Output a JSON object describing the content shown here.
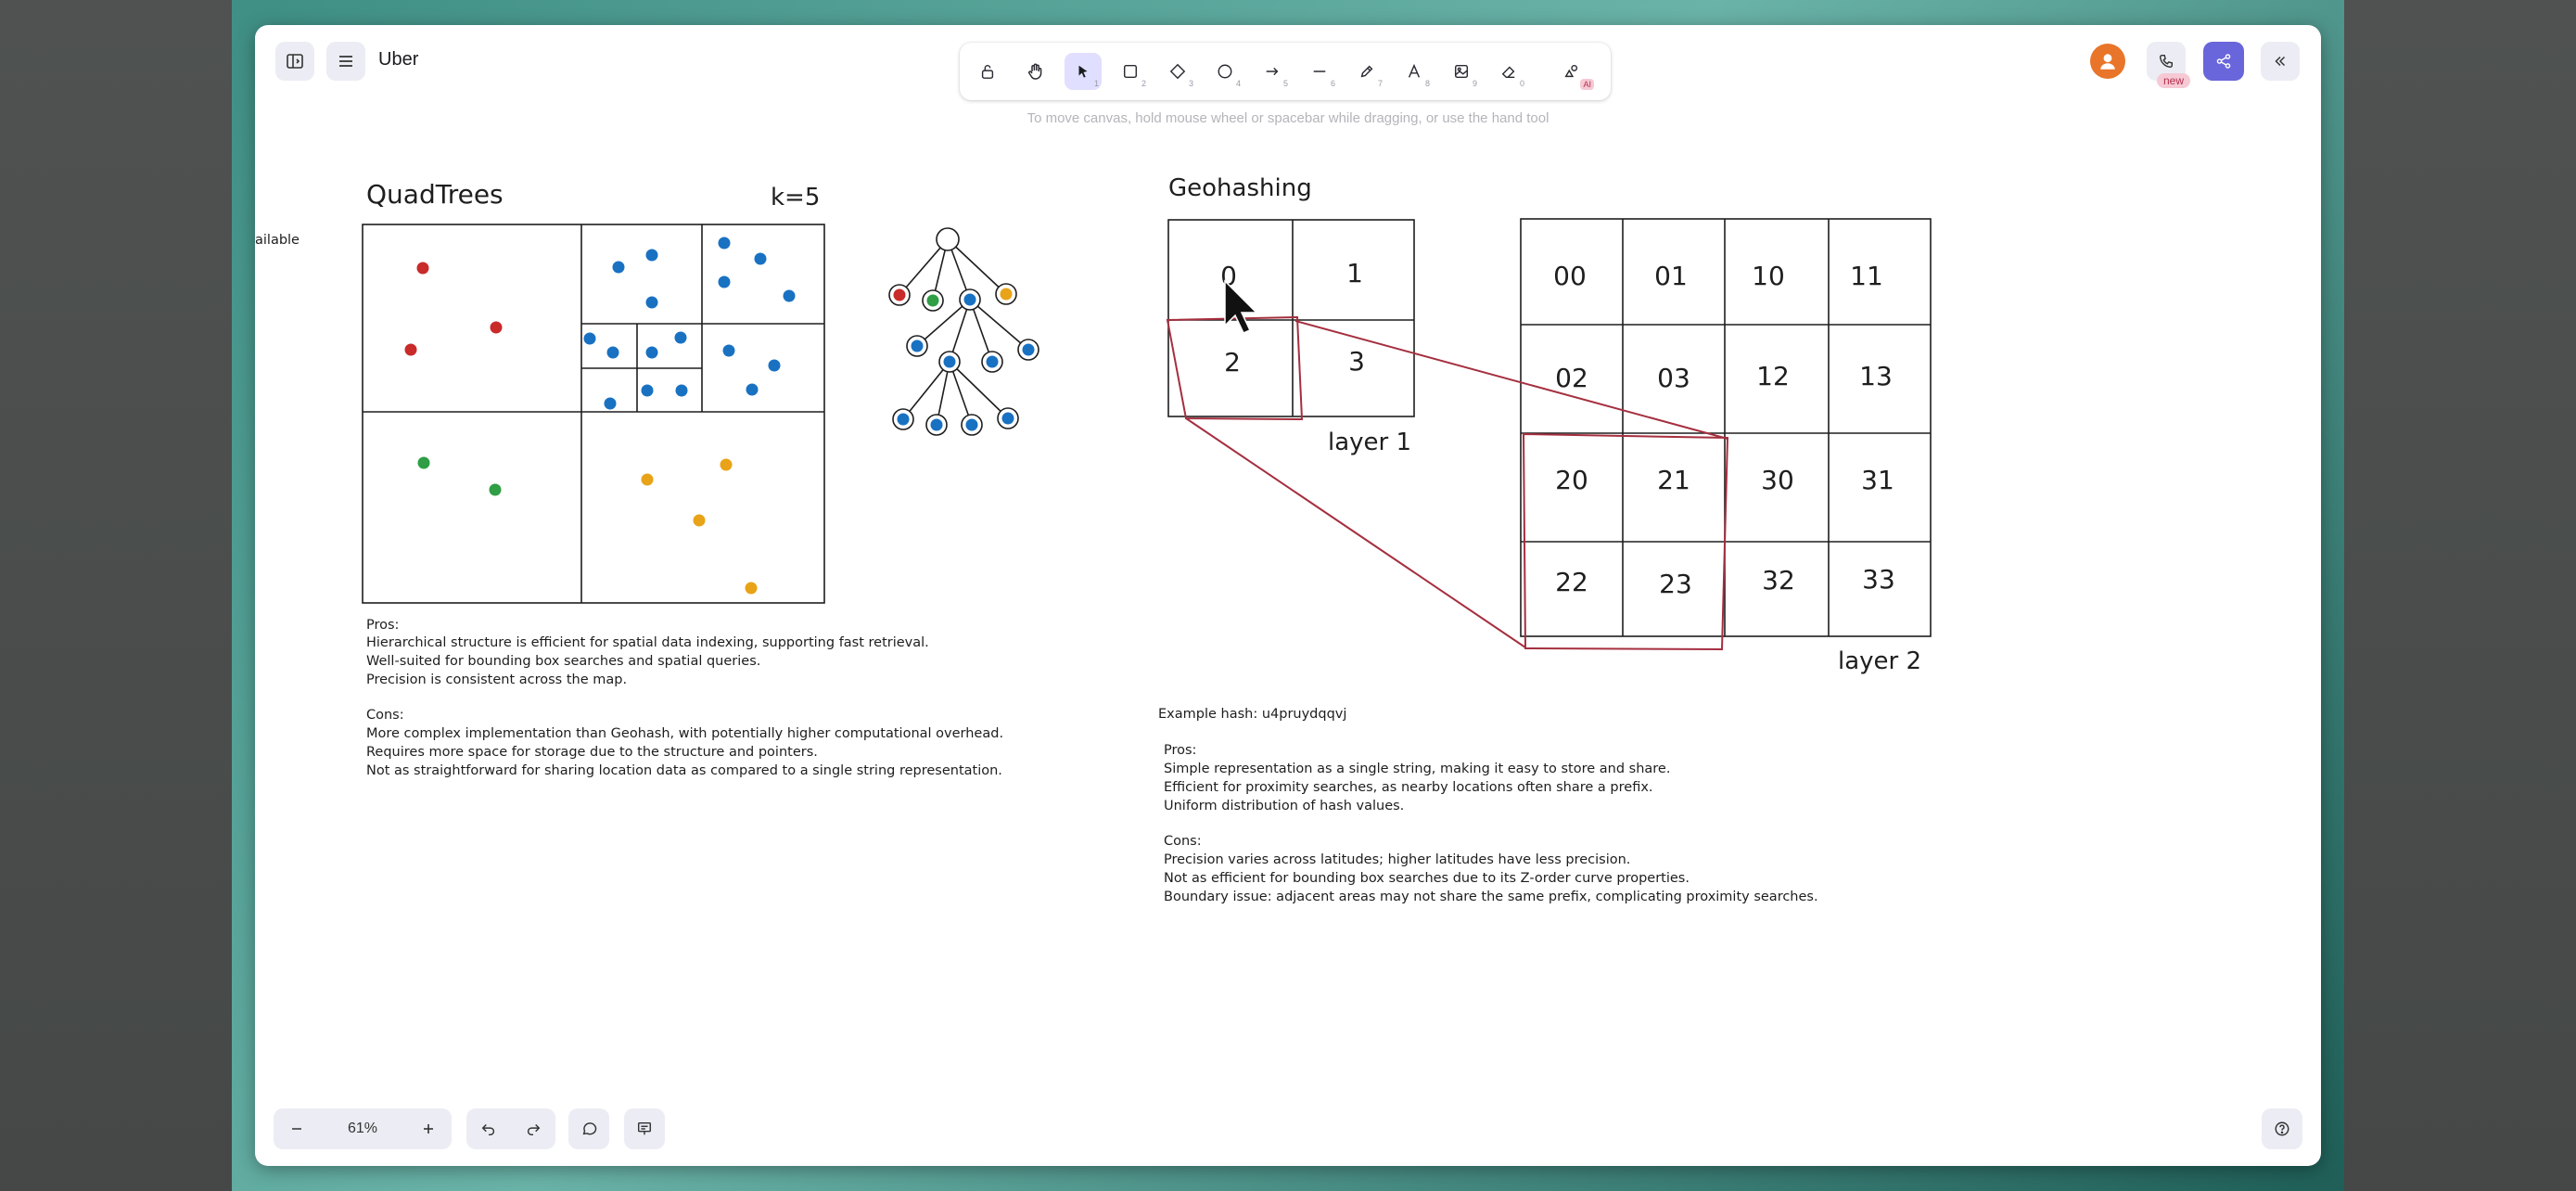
{
  "window": {
    "title": "Uber",
    "canvas_hint": "To move canvas, hold mouse wheel or spacebar while dragging, or use the hand tool"
  },
  "toolbar": {
    "tools": [
      {
        "name": "lock",
        "key": ""
      },
      {
        "name": "hand",
        "key": ""
      },
      {
        "name": "selection",
        "key": "1"
      },
      {
        "name": "rectangle",
        "key": "2"
      },
      {
        "name": "diamond",
        "key": "3"
      },
      {
        "name": "ellipse",
        "key": "4"
      },
      {
        "name": "arrow",
        "key": "5"
      },
      {
        "name": "line",
        "key": "6"
      },
      {
        "name": "draw",
        "key": "7"
      },
      {
        "name": "text",
        "key": "8"
      },
      {
        "name": "image",
        "key": "9"
      },
      {
        "name": "eraser",
        "key": "0"
      },
      {
        "name": "more-tools",
        "key": ""
      }
    ],
    "ai_badge": "AI"
  },
  "header_right": {
    "new_badge": "new"
  },
  "footer": {
    "zoom": "61%"
  },
  "canvas": {
    "left_edge_text": "ailable",
    "quadtrees": {
      "title": "QuadTrees",
      "k_label": "k=5",
      "pros_title": "Pros:",
      "pros": [
        "Hierarchical structure is efficient for spatial data indexing, supporting fast retrieval.",
        "Well-suited for bounding box searches and spatial queries.",
        "Precision is consistent across the map."
      ],
      "cons_title": "Cons:",
      "cons": [
        "More complex implementation than Geohash, with potentially higher computational overhead.",
        "Requires more space for storage due to the structure and pointers.",
        "Not as straightforward for sharing location data as compared to a single string representation."
      ]
    },
    "geohashing": {
      "title": "Geohashing",
      "layer1_cells": [
        "0",
        "1",
        "2",
        "3"
      ],
      "layer1_label": "layer 1",
      "layer2_cells": [
        "00",
        "01",
        "10",
        "11",
        "02",
        "03",
        "12",
        "13",
        "20",
        "21",
        "30",
        "31",
        "22",
        "23",
        "32",
        "33"
      ],
      "layer2_label": "layer 2",
      "example_hash": "Example hash: u4pruydqqvj",
      "pros_title": "Pros:",
      "pros": [
        "Simple representation as a single string, making it easy to store and share.",
        "Efficient for proximity searches, as nearby locations often share a prefix.",
        "Uniform distribution of hash values."
      ],
      "cons_title": "Cons:",
      "cons": [
        "Precision varies across latitudes; higher latitudes have less precision.",
        "Not as efficient for bounding box searches due to its Z-order curve properties.",
        "Boundary issue: adjacent areas may not share the same prefix, complicating proximity searches."
      ]
    }
  },
  "colors": {
    "red": "#c92a2a",
    "green": "#2f9e44",
    "blue": "#1971c2",
    "orange": "#e8a318",
    "accent": "#6965db",
    "highlight": "#a52f3f"
  }
}
